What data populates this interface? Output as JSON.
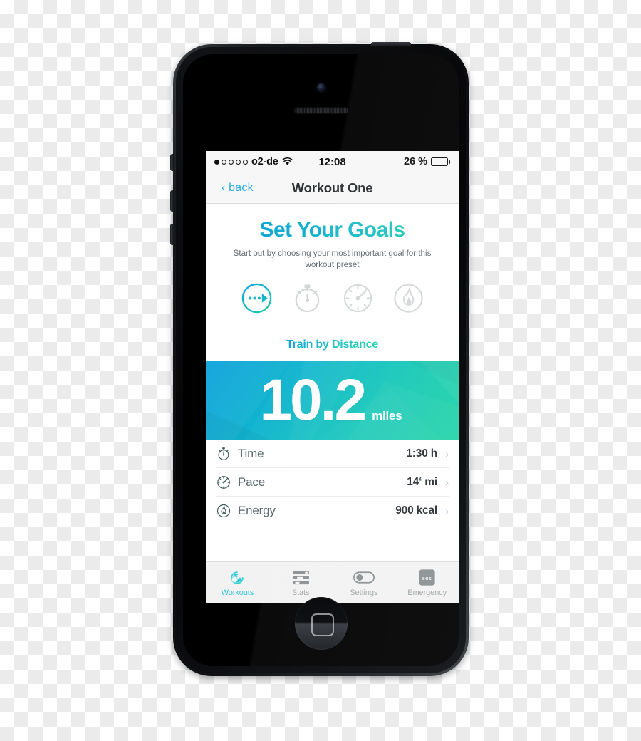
{
  "device": {
    "name": "iphone-5-black",
    "home_button": "home-button",
    "camera": "front-camera",
    "speaker": "earpiece-speaker"
  },
  "status_bar": {
    "signal_dots": [
      true,
      false,
      false,
      false,
      false
    ],
    "carrier": "o2-de",
    "wifi_icon": "wifi-icon",
    "time": "12:08",
    "battery_percent_label": "26 %",
    "battery_level": 26
  },
  "nav_bar": {
    "back_label": "‹ back",
    "title": "Workout One"
  },
  "goals": {
    "title": "Set Your Goals",
    "subtitle": "Start out by choosing your most important goal for this workout preset",
    "options": [
      {
        "id": "distance",
        "icon": "distance-icon",
        "active": true
      },
      {
        "id": "time",
        "icon": "stopwatch-icon",
        "active": false
      },
      {
        "id": "pace",
        "icon": "speedometer-icon",
        "active": false
      },
      {
        "id": "energy",
        "icon": "flame-icon",
        "active": false
      }
    ]
  },
  "train_by": {
    "label": "Train by Distance"
  },
  "hero": {
    "value": "10.2",
    "unit": "miles"
  },
  "details": {
    "rows": [
      {
        "icon": "stopwatch-icon",
        "label": "Time",
        "value": "1:30 h",
        "chevron": "›"
      },
      {
        "icon": "speedometer-icon",
        "label": "Pace",
        "value": "14‘ mi",
        "chevron": "›"
      },
      {
        "icon": "flame-icon",
        "label": "Energy",
        "value": "900 kcal",
        "chevron": "›"
      }
    ]
  },
  "tab_bar": {
    "tabs": [
      {
        "id": "workouts",
        "label": "Workouts",
        "icon": "workouts-spiral-icon",
        "active": true
      },
      {
        "id": "stats",
        "label": "Stats",
        "icon": "stats-bars-icon",
        "active": false
      },
      {
        "id": "settings",
        "label": "Settings",
        "icon": "toggle-switch-icon",
        "active": false
      },
      {
        "id": "emergency",
        "label": "Emergency",
        "icon": "sos-icon",
        "active": false
      }
    ],
    "sos_text": "sos"
  },
  "colors": {
    "accent_blue": "#0fa3dd",
    "accent_teal": "#1fd4a4",
    "link_blue": "#2aace2",
    "tab_active": "#2ec7d4",
    "text_dark": "#2b3135",
    "text_muted": "#5f6b70",
    "icon_inactive": "#d3d6d7"
  }
}
